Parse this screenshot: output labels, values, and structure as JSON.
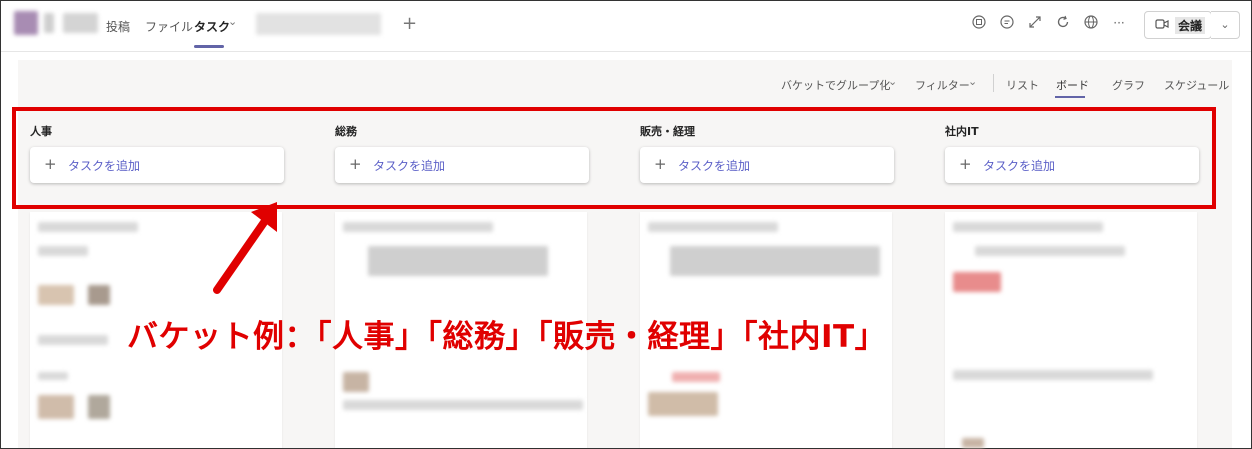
{
  "tabs": [
    {
      "label": "投稿"
    },
    {
      "label": "ファイル"
    },
    {
      "label": "タスク"
    }
  ],
  "tab_chevron": "⌄",
  "add_tab": "+",
  "header_icons": [
    "ext-icon",
    "chat-icon",
    "expand-icon",
    "refresh-icon",
    "globe-icon",
    "more-icon"
  ],
  "more": "···",
  "meeting_button": {
    "label": "会議",
    "dropdown": "⌄"
  },
  "toolbar": {
    "group_by": "バケットでグループ化",
    "filter": "フィルター",
    "views": [
      "リスト",
      "ボード",
      "グラフ",
      "スケジュール"
    ],
    "active_view": "ボード",
    "chevron": "⌄"
  },
  "buckets": [
    {
      "name": "人事",
      "add_task": "タスクを追加"
    },
    {
      "name": "総務",
      "add_task": "タスクを追加"
    },
    {
      "name": "販売・経理",
      "add_task": "タスクを追加"
    },
    {
      "name": "社内IT",
      "add_task": "タスクを追加"
    }
  ],
  "annotation": "バケット例：「人事」「総務」「販売・経理」「社内IT」",
  "colors": {
    "accent": "#6264a7",
    "annotation_red": "#e00000"
  }
}
